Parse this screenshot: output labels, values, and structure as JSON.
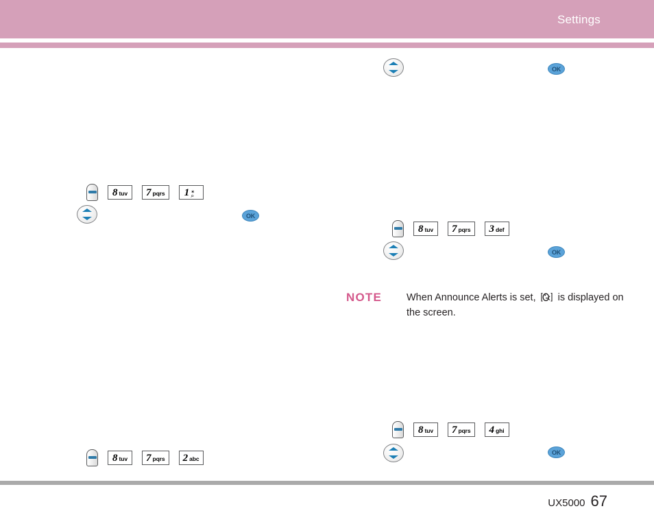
{
  "header": {
    "title": "Settings",
    "band_color": "#d5a0b9"
  },
  "footer": {
    "model": "UX5000",
    "page_number": "67",
    "rule_color": "#aaaaaa"
  },
  "note": {
    "label": "NOTE",
    "label_color": "#d4588b",
    "text_before": "When Announce Alerts is set,",
    "icon_name": "announce-alerts-icon",
    "text_after": "is displayed on the screen."
  },
  "key_sequences": [
    {
      "id": "seq-left-top",
      "keys": [
        {
          "type": "softkey",
          "label": "Menu"
        },
        {
          "type": "numkey",
          "digit": "8",
          "letters": "tuv"
        },
        {
          "type": "numkey",
          "digit": "7",
          "letters": "pqrs"
        },
        {
          "type": "numkey",
          "digit": "1",
          "letters": "voicemail"
        }
      ]
    },
    {
      "id": "seq-left-top-nav",
      "keys": [
        {
          "type": "navkey",
          "label": "Navigation"
        },
        {
          "type": "okkey",
          "label": "OK"
        }
      ]
    },
    {
      "id": "seq-right-top-nav",
      "keys": [
        {
          "type": "navkey",
          "label": "Navigation"
        },
        {
          "type": "okkey",
          "label": "OK"
        }
      ]
    },
    {
      "id": "seq-right-mid",
      "keys": [
        {
          "type": "softkey",
          "label": "Menu"
        },
        {
          "type": "numkey",
          "digit": "8",
          "letters": "tuv"
        },
        {
          "type": "numkey",
          "digit": "7",
          "letters": "pqrs"
        },
        {
          "type": "numkey",
          "digit": "3",
          "letters": "def"
        }
      ]
    },
    {
      "id": "seq-right-mid-nav",
      "keys": [
        {
          "type": "navkey",
          "label": "Navigation"
        },
        {
          "type": "okkey",
          "label": "OK"
        }
      ]
    },
    {
      "id": "seq-right-bottom",
      "keys": [
        {
          "type": "softkey",
          "label": "Menu"
        },
        {
          "type": "numkey",
          "digit": "8",
          "letters": "tuv"
        },
        {
          "type": "numkey",
          "digit": "7",
          "letters": "pqrs"
        },
        {
          "type": "numkey",
          "digit": "4",
          "letters": "ghi"
        }
      ]
    },
    {
      "id": "seq-right-bottom-nav",
      "keys": [
        {
          "type": "navkey",
          "label": "Navigation"
        },
        {
          "type": "okkey",
          "label": "OK"
        }
      ]
    },
    {
      "id": "seq-left-bottom",
      "keys": [
        {
          "type": "softkey",
          "label": "Menu"
        },
        {
          "type": "numkey",
          "digit": "8",
          "letters": "tuv"
        },
        {
          "type": "numkey",
          "digit": "7",
          "letters": "pqrs"
        },
        {
          "type": "numkey",
          "digit": "2",
          "letters": "abc"
        }
      ]
    }
  ],
  "labels": {
    "ok": "OK",
    "digit_8": "8",
    "digit_7": "7",
    "digit_1": "1",
    "digit_2": "2",
    "digit_3": "3",
    "digit_4": "4",
    "letters_tuv": "tuv",
    "letters_pqrs": "pqrs",
    "letters_abc": "abc",
    "letters_def": "def",
    "letters_ghi": "ghi"
  }
}
